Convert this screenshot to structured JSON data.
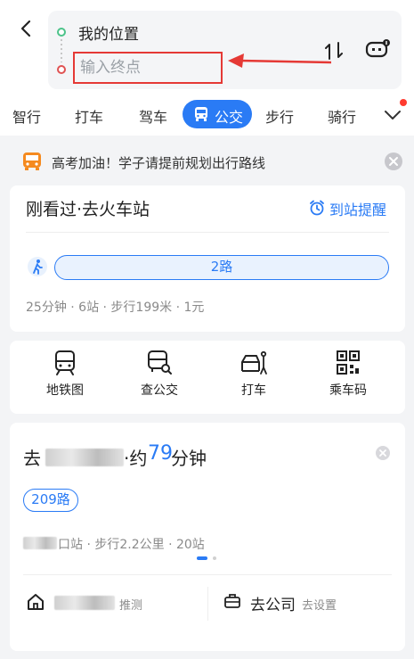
{
  "header": {
    "start_location": "我的位置",
    "end_placeholder": "输入终点"
  },
  "tabs": [
    {
      "label": "智行"
    },
    {
      "label": "打车"
    },
    {
      "label": "驾车"
    },
    {
      "label": "公交",
      "active": true
    },
    {
      "label": "步行"
    },
    {
      "label": "骑行"
    }
  ],
  "notice": {
    "text": "高考加油！学子请提前规划出行路线"
  },
  "recent": {
    "title": "刚看过·去火车站",
    "remind": "到站提醒",
    "route_name": "2路",
    "meta": "25分钟 · 6站 · 步行199米 · 1元"
  },
  "tools": [
    {
      "label": "地铁图",
      "icon": "subway-icon"
    },
    {
      "label": "查公交",
      "icon": "bus-search-icon"
    },
    {
      "label": "打车",
      "icon": "taxi-icon"
    },
    {
      "label": "乘车码",
      "icon": "qr-code-icon"
    }
  ],
  "destination": {
    "prefix": "去",
    "mid": "·约",
    "minutes": "79",
    "suffix": "分钟",
    "bus": "209路",
    "meta_suffix": "口站 · 步行2.2公里 · 20站",
    "home_infer": "推测",
    "office": "去公司",
    "office_set": "去设置"
  },
  "colors": {
    "accent": "#2a7bf5",
    "highlight": "#e53935"
  }
}
